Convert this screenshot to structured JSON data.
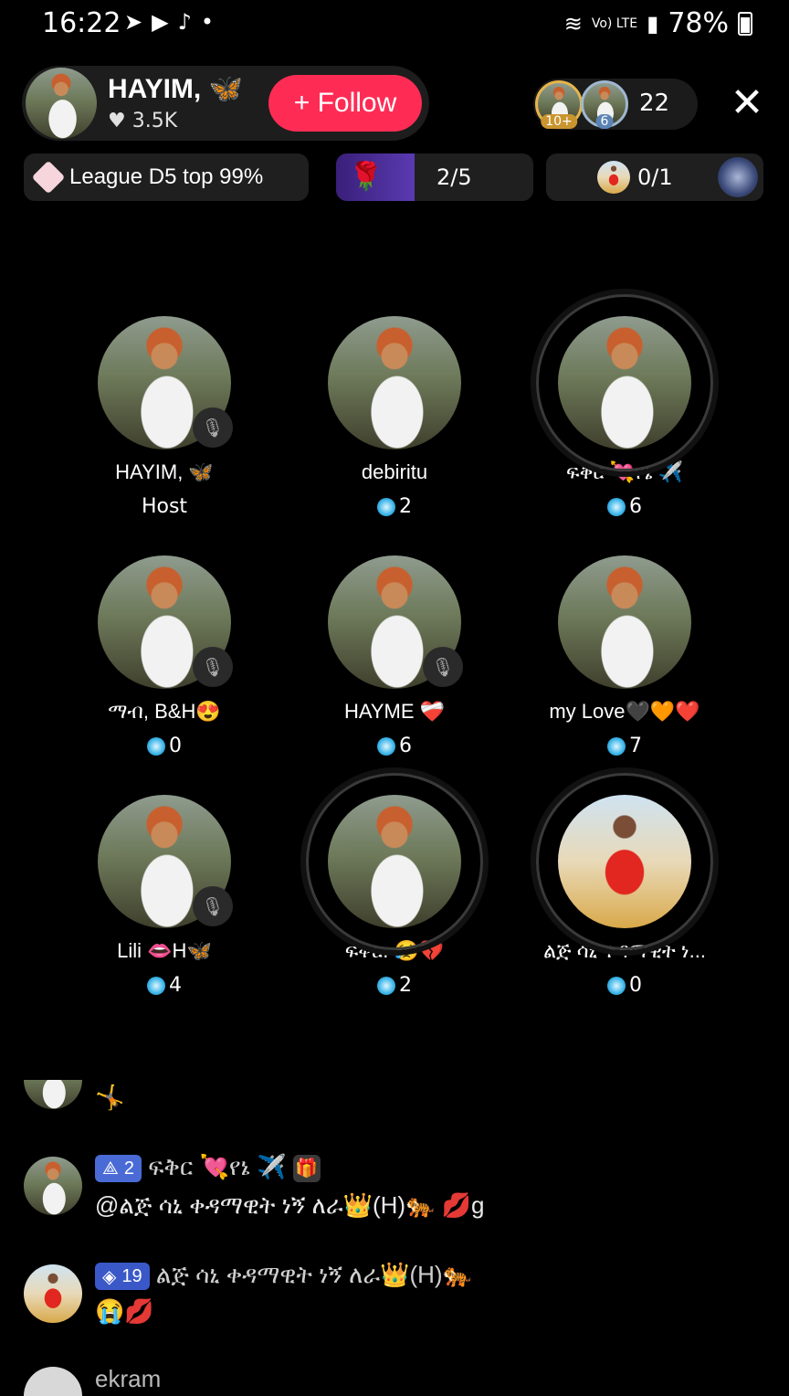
{
  "status_bar": {
    "time": "16:22",
    "app_icons": [
      "telegram-icon",
      "youtube-icon",
      "tiktok-icon",
      "dot-icon"
    ],
    "network": "Vo) LTE",
    "battery": "78%"
  },
  "header": {
    "host_name": "HAYIM, 🦋",
    "likes": "♥ 3.5K",
    "follow_label": "+ Follow",
    "viewer_badges": [
      "10+",
      "6"
    ],
    "viewer_count": "22",
    "close_glyph": "✕"
  },
  "stats": {
    "league": "League D5 top 99%",
    "rose_goal": "2/5",
    "rose_progress": 0.4,
    "rose_icon": "🌹",
    "host_goal": "0/1"
  },
  "seats": [
    {
      "name": "HAYIM, 🦋",
      "sub": "Host",
      "coins": null,
      "muted": true,
      "ring": false,
      "pic": "host"
    },
    {
      "name": "debiritu",
      "sub": "",
      "coins": "2",
      "muted": false,
      "ring": false,
      "pic": "host"
    },
    {
      "name": "ፍቅር 💘የኔ ✈️",
      "sub": "",
      "coins": "6",
      "muted": false,
      "ring": true,
      "pic": "host"
    },
    {
      "name": "ማብ, B&H😍",
      "sub": "",
      "coins": "0",
      "muted": true,
      "ring": false,
      "pic": "host"
    },
    {
      "name": "HAYME ❤️‍🩹",
      "sub": "",
      "coins": "6",
      "muted": true,
      "ring": false,
      "pic": "host"
    },
    {
      "name": "my Love🖤🧡❤️",
      "sub": "",
      "coins": "7",
      "muted": false,
      "ring": false,
      "pic": "host"
    },
    {
      "name": "Lili 👄H🦋",
      "sub": "",
      "coins": "4",
      "muted": true,
      "ring": false,
      "pic": "host"
    },
    {
      "name": "ፍቅር. 😥💔",
      "sub": "",
      "coins": "2",
      "muted": false,
      "ring": true,
      "pic": "host"
    },
    {
      "name": "ልጅ ሳኒ ቀዳማዊት ነ...",
      "sub": "",
      "coins": "0",
      "muted": false,
      "ring": true,
      "pic": "red"
    }
  ],
  "chat": [
    {
      "partial": "🤸"
    },
    {
      "level": "2",
      "level_icon": "⟁",
      "user": "ፍቅር 💘የኔ ✈️",
      "gift": "🎁",
      "text": "@ልጅ ሳኒ ቀዳማዊት ነኝ ለራ👑(H)🐅 💋g"
    },
    {
      "level": "19",
      "level_icon": "◈",
      "user": "ልጅ ሳኒ ቀዳማዊት ነኝ ለራ👑(H)🐅",
      "text": "😭💋"
    },
    {
      "user": "ekram"
    }
  ]
}
